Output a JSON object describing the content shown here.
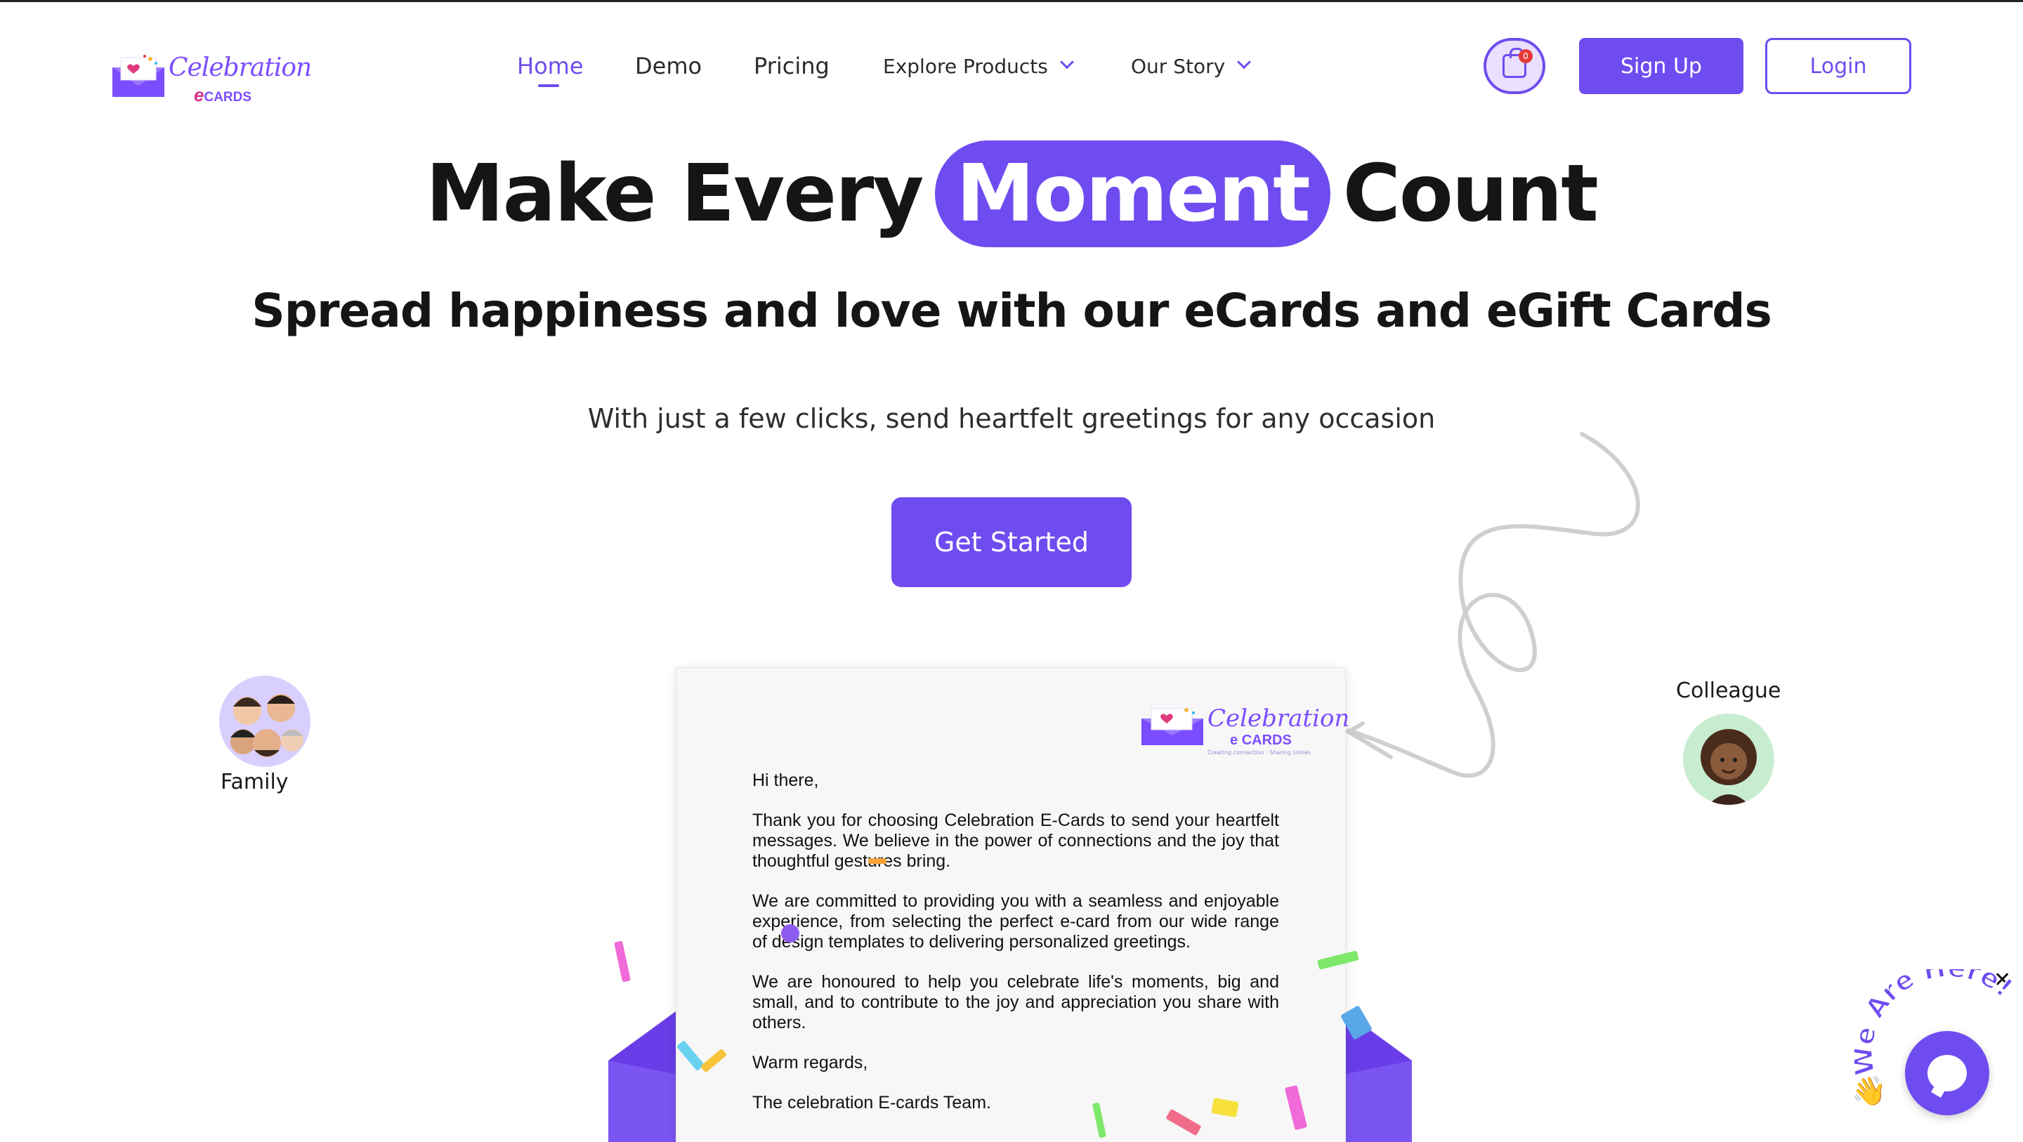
{
  "brand": {
    "name": "Celebration",
    "sub_e": "e",
    "sub_cards": "CARDS",
    "tagline": "Creating connection · Sharing smiles"
  },
  "nav": {
    "home": "Home",
    "demo": "Demo",
    "pricing": "Pricing",
    "explore": "Explore Products",
    "story": "Our Story"
  },
  "cart": {
    "count": "0",
    "icon": "shopping-bag-icon"
  },
  "auth": {
    "signup": "Sign Up",
    "login": "Login"
  },
  "hero": {
    "title_before": "Make Every",
    "title_highlight": "Moment",
    "title_after": "Count",
    "subtitle": "Spread happiness and love with our eCards and eGift Cards",
    "description": "With just a few clicks, send heartfelt greetings for any occasion",
    "cta": "Get Started"
  },
  "avatars": {
    "family_label": "Family",
    "colleague_label": "Colleague"
  },
  "letter": {
    "greeting": "Hi there,",
    "p1": "Thank you for choosing Celebration E-Cards to send your heartfelt messages. We believe in the power of connections and the joy that thoughtful gestures bring.",
    "p2": "We are committed to providing you with a seamless and enjoyable experience, from selecting the perfect e-card from our wide range of design templates to delivering personalized greetings.",
    "p3": "We are honoured to help you celebrate life's moments, big and small, and to contribute to the joy and appreciation you share with others.",
    "closing": "Warm regards,",
    "signature": "The celebration E-cards Team."
  },
  "chat": {
    "badge": "We Are Here!",
    "close": "✕",
    "icon": "chat-bubble-icon"
  },
  "colors": {
    "accent": "#6f4cf0",
    "pill": "#6f4cf0",
    "avatar_family_bg": "#d9cfff",
    "avatar_colleague_bg": "#c8ecd0"
  }
}
